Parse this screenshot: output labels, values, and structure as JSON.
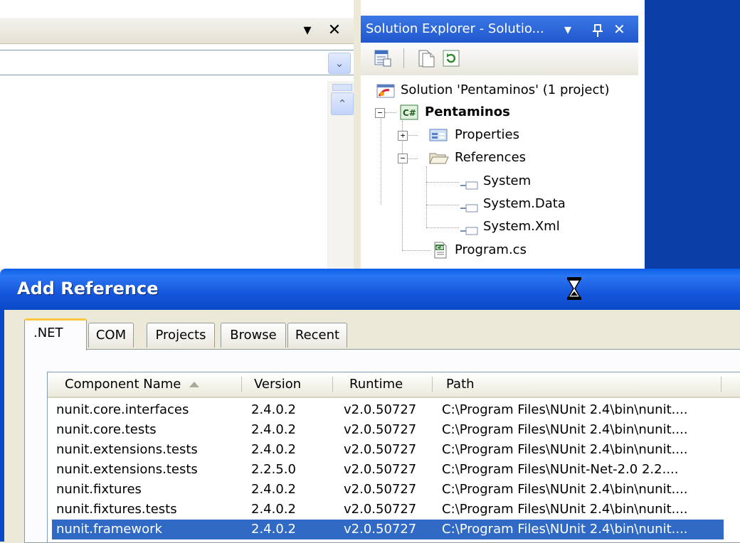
{
  "editor": {
    "dropdown_glyph": "▾",
    "close_glyph": "✕",
    "combo_arrow": "⌄",
    "scroll_up_arrow": "⌃"
  },
  "solution_explorer": {
    "title": "Solution Explorer - Solutio...",
    "dropdown_glyph": "▾",
    "pin_glyph": "ᵖ",
    "close_glyph": "✕",
    "tree": {
      "solution": "Solution 'Pentaminos' (1 project)",
      "project": "Pentaminos",
      "properties": "Properties",
      "references": "References",
      "ref_items": [
        "System",
        "System.Data",
        "System.Xml"
      ],
      "program": "Program.cs"
    }
  },
  "dialog": {
    "title": "Add Reference",
    "tabs": [
      ".NET",
      "COM",
      "Projects",
      "Browse",
      "Recent"
    ],
    "active_tab": ".NET",
    "columns": [
      "Component Name",
      "Version",
      "Runtime",
      "Path"
    ],
    "rows": [
      {
        "name": "nunit.core.interfaces",
        "version": "2.4.0.2",
        "runtime": "v2.0.50727",
        "path": "C:\\Program Files\\NUnit 2.4\\bin\\nunit...."
      },
      {
        "name": "nunit.core.tests",
        "version": "2.4.0.2",
        "runtime": "v2.0.50727",
        "path": "C:\\Program Files\\NUnit 2.4\\bin\\nunit...."
      },
      {
        "name": "nunit.extensions.tests",
        "version": "2.4.0.2",
        "runtime": "v2.0.50727",
        "path": "C:\\Program Files\\NUnit 2.4\\bin\\nunit...."
      },
      {
        "name": "nunit.extensions.tests",
        "version": "2.2.5.0",
        "runtime": "v2.0.50727",
        "path": "C:\\Program Files\\NUnit-Net-2.0 2.2...."
      },
      {
        "name": "nunit.fixtures",
        "version": "2.4.0.2",
        "runtime": "v2.0.50727",
        "path": "C:\\Program Files\\NUnit 2.4\\bin\\nunit...."
      },
      {
        "name": "nunit.fixtures.tests",
        "version": "2.4.0.2",
        "runtime": "v2.0.50727",
        "path": "C:\\Program Files\\NUnit 2.4\\bin\\nunit...."
      },
      {
        "name": "nunit.framework",
        "version": "2.4.0.2",
        "runtime": "v2.0.50727",
        "path": "C:\\Program Files\\NUnit 2.4\\bin\\nunit....",
        "selected": true
      }
    ]
  },
  "colors": {
    "xp_title_blue": "#0a4ac8",
    "selection_blue": "#316ac5",
    "tab_highlight": "#ffc83c",
    "dialog_face": "#ece9d8"
  }
}
